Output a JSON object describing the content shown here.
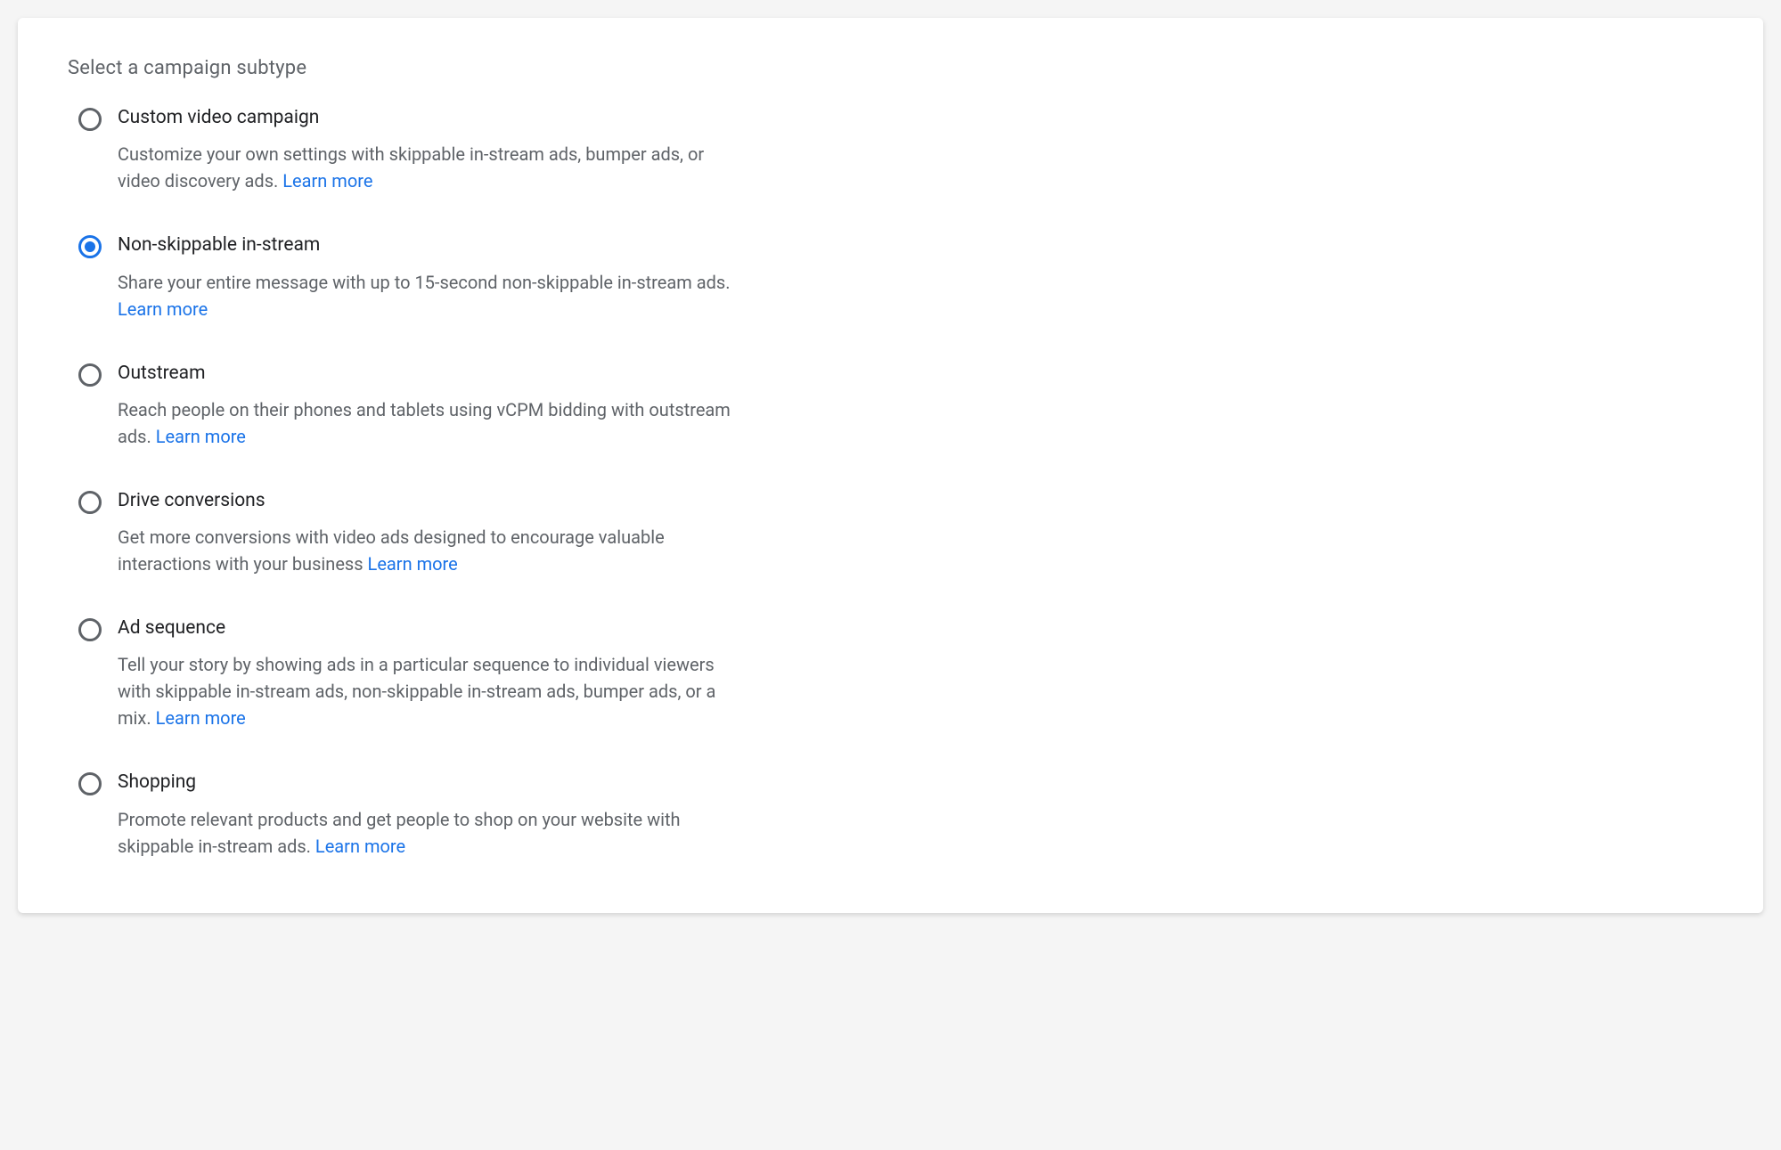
{
  "section_title": "Select a campaign subtype",
  "learn_more_label": "Learn more",
  "selected_index": 1,
  "options": [
    {
      "id": "custom-video-campaign",
      "title": "Custom video campaign",
      "description": "Customize your own settings with skippable in-stream ads, bumper ads, or video discovery ads."
    },
    {
      "id": "non-skippable-in-stream",
      "title": "Non-skippable in-stream",
      "description": "Share your entire message with up to 15-second non-skippable in-stream ads."
    },
    {
      "id": "outstream",
      "title": "Outstream",
      "description": "Reach people on their phones and tablets using vCPM bidding with outstream ads."
    },
    {
      "id": "drive-conversions",
      "title": "Drive conversions",
      "description": "Get more conversions with video ads designed to encourage valuable interactions with your business"
    },
    {
      "id": "ad-sequence",
      "title": "Ad sequence",
      "description": "Tell your story by showing ads in a particular sequence to individual viewers with skippable in-stream ads, non-skippable in-stream ads, bumper ads, or a mix."
    },
    {
      "id": "shopping",
      "title": "Shopping",
      "description": "Promote relevant products and get people to shop on your website with skippable in-stream ads."
    }
  ]
}
